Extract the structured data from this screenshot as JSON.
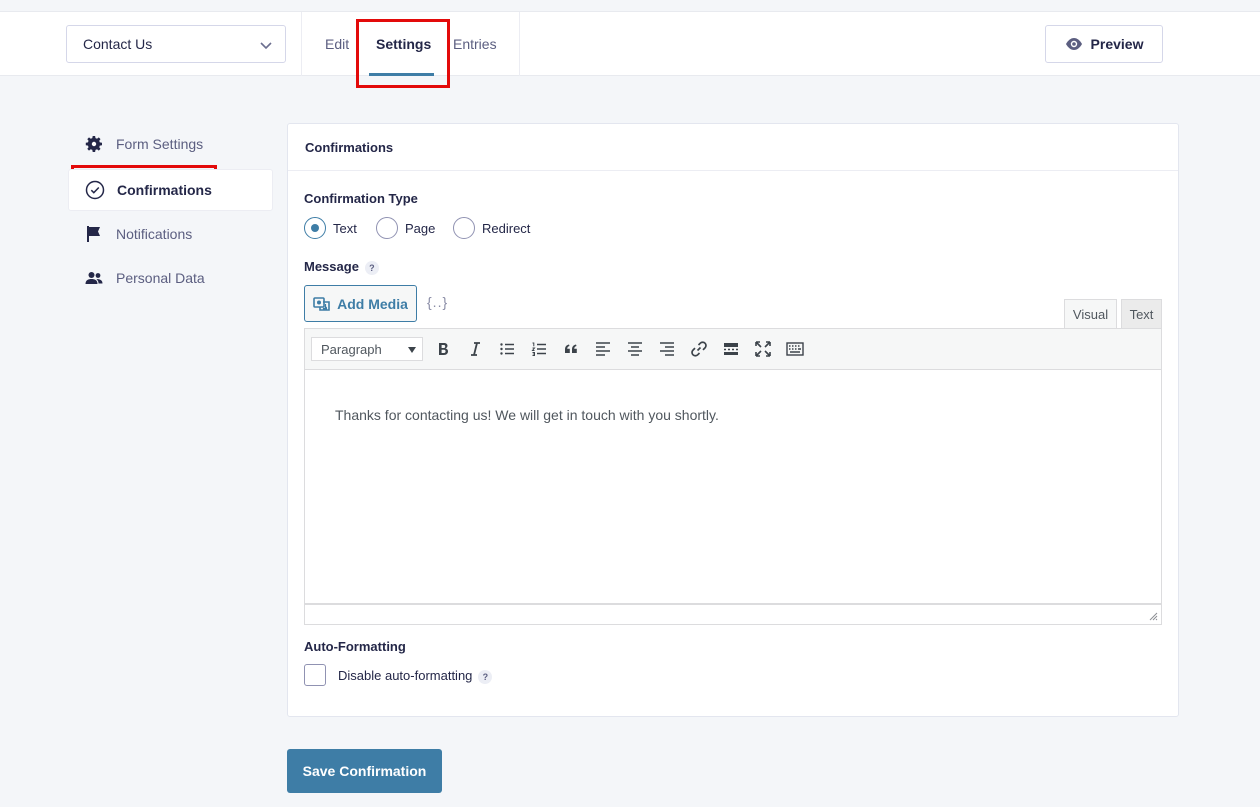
{
  "header": {
    "form_selector": "Contact Us",
    "tabs": [
      {
        "label": "Edit"
      },
      {
        "label": "Settings"
      },
      {
        "label": "Entries"
      }
    ],
    "active_tab": "Settings",
    "preview_label": "Preview"
  },
  "sidebar": {
    "items": [
      {
        "label": "Form Settings",
        "icon": "gear-icon"
      },
      {
        "label": "Confirmations",
        "icon": "check-circle-icon"
      },
      {
        "label": "Notifications",
        "icon": "flag-icon"
      },
      {
        "label": "Personal Data",
        "icon": "people-icon"
      }
    ],
    "active_item": "Confirmations"
  },
  "panel": {
    "title": "Confirmations",
    "confirmation_type_label": "Confirmation Type",
    "confirmation_types": [
      {
        "label": "Text",
        "selected": true
      },
      {
        "label": "Page",
        "selected": false
      },
      {
        "label": "Redirect",
        "selected": false
      }
    ],
    "message_label": "Message",
    "help_glyph": "?",
    "add_media_label": "Add Media",
    "merge_tag_glyph": "{..}",
    "editor_tabs": {
      "visual": "Visual",
      "text": "Text"
    },
    "format_select": "Paragraph",
    "message_text": "Thanks for contacting us! We will get in touch with you shortly.",
    "auto_format_label": "Auto-Formatting",
    "disable_auto_format_label": "Disable auto-formatting",
    "disable_auto_format_checked": false
  },
  "footer": {
    "save_label": "Save Confirmation"
  },
  "colors": {
    "accent": "#3e7da6",
    "highlight": "#e30a0a",
    "background": "#f4f6f9"
  }
}
